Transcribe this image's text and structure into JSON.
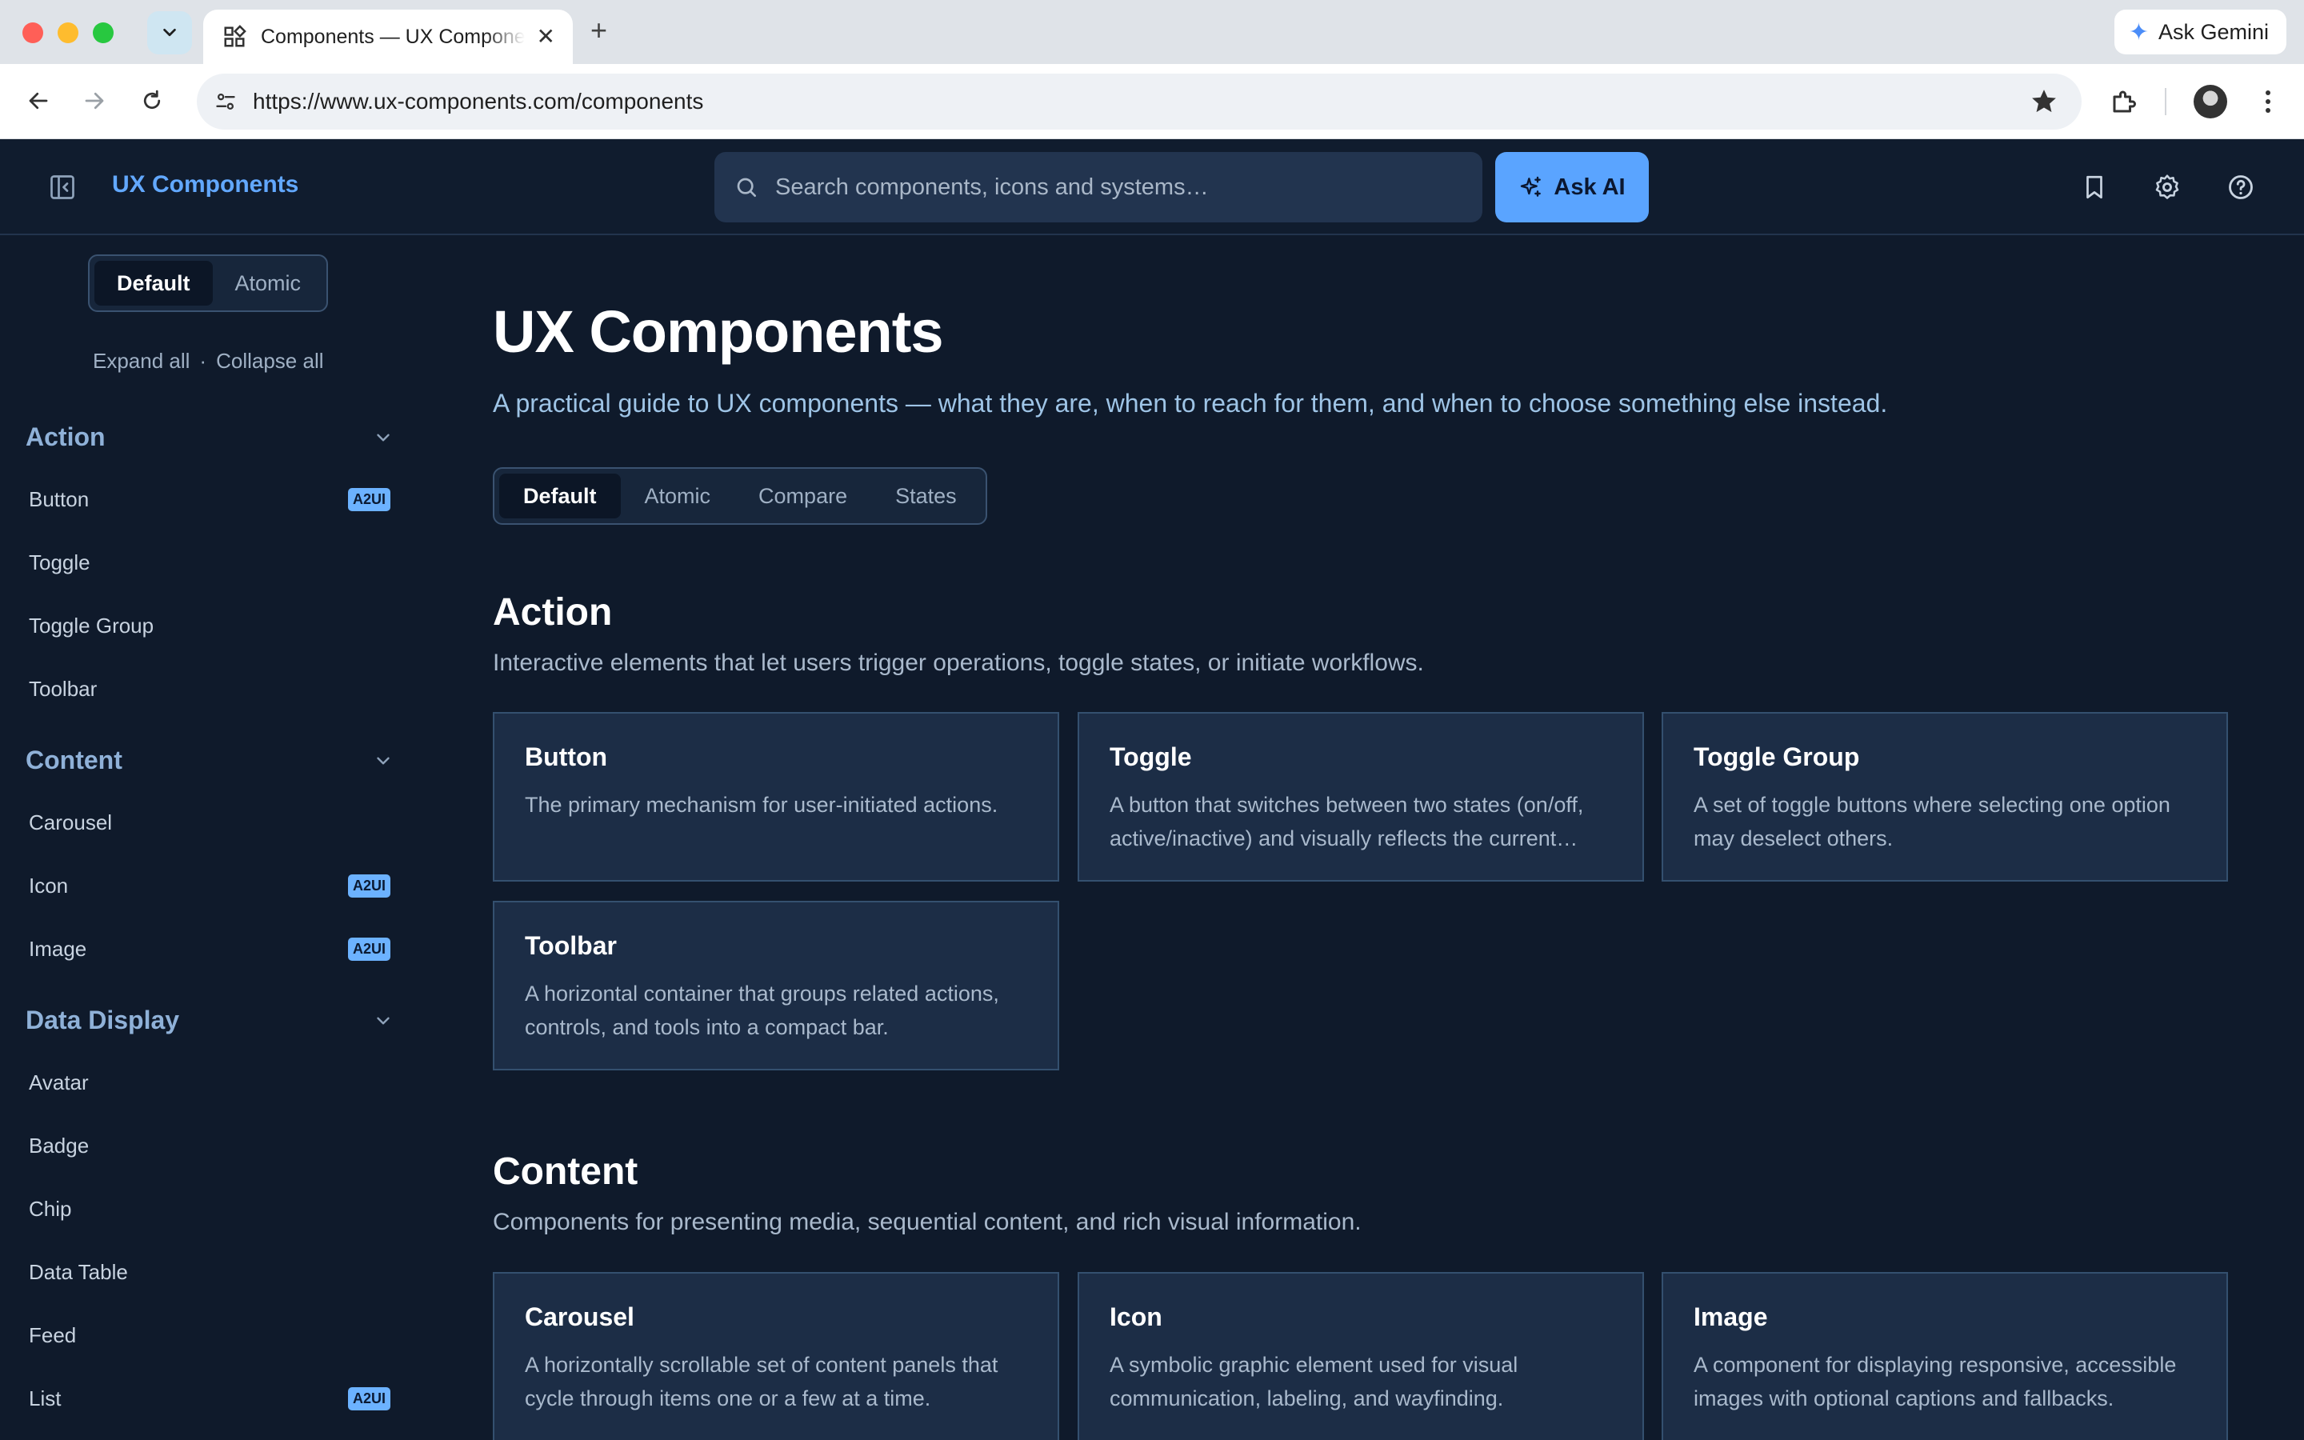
{
  "browser": {
    "tab_title": "Components — UX Components",
    "new_tab_label": "+",
    "close_tab_label": "✕",
    "gemini_label": "Ask Gemini",
    "url": "https://www.ux-components.com/components"
  },
  "header": {
    "brand": "UX Components",
    "search_placeholder": "Search components, icons and systems…",
    "ask_ai_label": "Ask AI"
  },
  "sidebar": {
    "modes": [
      "Default",
      "Atomic"
    ],
    "active_mode": "Default",
    "expand_all": "Expand all",
    "separator": "·",
    "collapse_all": "Collapse all",
    "categories": [
      {
        "label": "Action",
        "items": [
          {
            "label": "Button",
            "badge": "A2UI"
          },
          {
            "label": "Toggle",
            "badge": ""
          },
          {
            "label": "Toggle Group",
            "badge": ""
          },
          {
            "label": "Toolbar",
            "badge": ""
          }
        ]
      },
      {
        "label": "Content",
        "items": [
          {
            "label": "Carousel",
            "badge": ""
          },
          {
            "label": "Icon",
            "badge": "A2UI"
          },
          {
            "label": "Image",
            "badge": "A2UI"
          }
        ]
      },
      {
        "label": "Data Display",
        "items": [
          {
            "label": "Avatar",
            "badge": ""
          },
          {
            "label": "Badge",
            "badge": ""
          },
          {
            "label": "Chip",
            "badge": ""
          },
          {
            "label": "Data Table",
            "badge": ""
          },
          {
            "label": "Feed",
            "badge": ""
          },
          {
            "label": "List",
            "badge": "A2UI"
          }
        ]
      }
    ]
  },
  "main": {
    "title": "UX Components",
    "subtitle": "A practical guide to UX components — what they are, when to reach for them, and when to choose something else instead.",
    "tabs": [
      "Default",
      "Atomic",
      "Compare",
      "States"
    ],
    "active_tab": "Default",
    "sections": [
      {
        "title": "Action",
        "description": "Interactive elements that let users trigger operations, toggle states, or initiate workflows.",
        "cards": [
          {
            "title": "Button",
            "description": "The primary mechanism for user-initiated actions."
          },
          {
            "title": "Toggle",
            "description": "A button that switches between two states (on/off, active/inactive) and visually reflects the current state."
          },
          {
            "title": "Toggle Group",
            "description": "A set of toggle buttons where selecting one option may deselect others."
          },
          {
            "title": "Toolbar",
            "description": "A horizontal container that groups related actions, controls, and tools into a compact bar."
          }
        ]
      },
      {
        "title": "Content",
        "description": "Components for presenting media, sequential content, and rich visual information.",
        "cards": [
          {
            "title": "Carousel",
            "description": "A horizontally scrollable set of content panels that cycle through items one or a few at a time."
          },
          {
            "title": "Icon",
            "description": "A symbolic graphic element used for visual communication, labeling, and wayfinding."
          },
          {
            "title": "Image",
            "description": "A component for displaying responsive, accessible images with optional captions and fallbacks."
          }
        ]
      }
    ]
  }
}
